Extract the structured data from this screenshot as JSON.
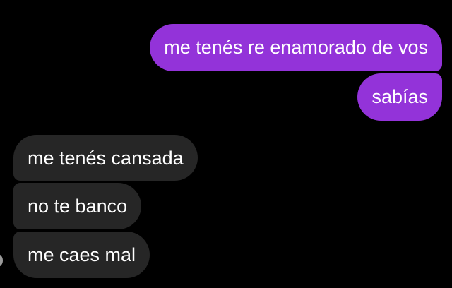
{
  "conversation": {
    "messages": [
      {
        "direction": "sent",
        "text": "me tenés re enamorado de vos"
      },
      {
        "direction": "sent",
        "text": "sabías"
      },
      {
        "direction": "received",
        "text": "me tenés cansada"
      },
      {
        "direction": "received",
        "text": "no te banco"
      },
      {
        "direction": "received",
        "text": "me caes mal"
      }
    ]
  },
  "colors": {
    "background": "#000000",
    "sent_bubble": "#9333d9",
    "received_bubble": "#262626",
    "text": "#ffffff"
  },
  "icons": {
    "contact_avatar": "avatar-icon"
  }
}
